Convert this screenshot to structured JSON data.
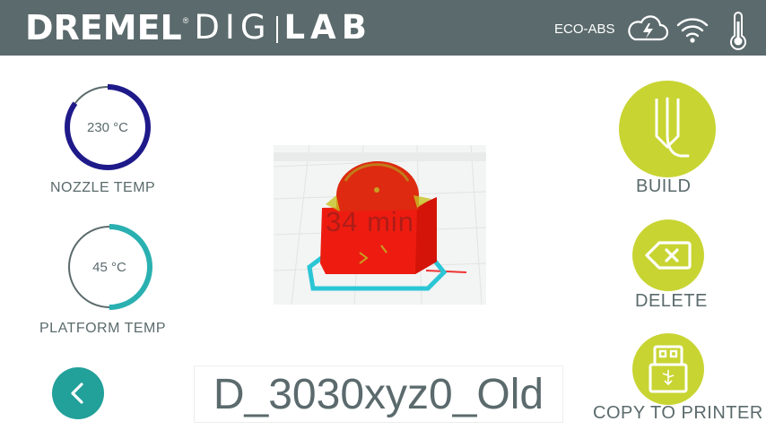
{
  "header": {
    "brand": "DREMEL",
    "brand_mark": "®",
    "product_d": "D",
    "product_i1": "I",
    "product_g": "G",
    "product_i2": "I",
    "product_lab": "LAB",
    "filament": "ECO-ABS",
    "icons": [
      "cloud-icon",
      "wifi-icon",
      "thermometer-icon"
    ],
    "bg_color": "#5b6a6c"
  },
  "nozzle": {
    "value": "230 °C",
    "label": "NOZZLE TEMP",
    "level": 0.85,
    "color": "#1f1a8a"
  },
  "platform": {
    "value": "45 °C",
    "label": "PLATFORM TEMP",
    "level": 0.5,
    "color": "#2ab0b0"
  },
  "preview": {
    "print_time": "34 min"
  },
  "file": {
    "name": "D_3030xyz0_Old"
  },
  "actions": {
    "build": "BUILD",
    "delete": "DELETE",
    "copy": "COPY TO PRINTER",
    "accent": "#c8d432"
  },
  "nav": {
    "back_color": "#22a09a"
  }
}
